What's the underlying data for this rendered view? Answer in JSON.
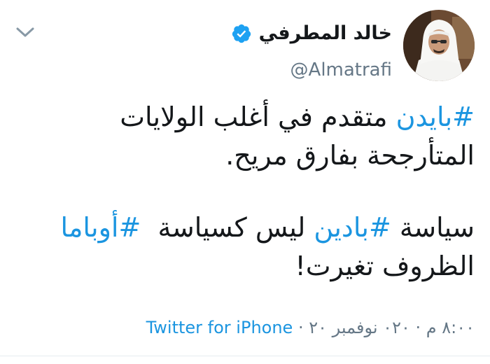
{
  "author": {
    "display_name": "خالد المطرفي",
    "handle": "@Almatrafi",
    "verified": true,
    "avatar_icon": "user-avatar-photo"
  },
  "menu": {
    "icon": "chevron-down-icon"
  },
  "tweet": {
    "line1_hashtag": "#بايدن",
    "line1_text": " متقدم في أغلب الولايات",
    "line2_text": "المتأرجحة بفارق مريح.",
    "line3_prefix": "سياسة ",
    "line3_hashtag1": "#بادين",
    "line3_middle": " ليس كسياسة  ",
    "line3_hashtag2": "#أوباما",
    "line4_text": "الظروف تغيرت!"
  },
  "meta": {
    "time": "٨:٠٠ م",
    "separator1": " · ",
    "date": "٠٢٠ نوفمبر ٢٠",
    "separator2": " · ",
    "source": "Twitter for iPhone"
  },
  "colors": {
    "link": "#1b95e0",
    "text": "#14171a",
    "muted": "#657786",
    "verified_badge": "#1da1f2"
  }
}
